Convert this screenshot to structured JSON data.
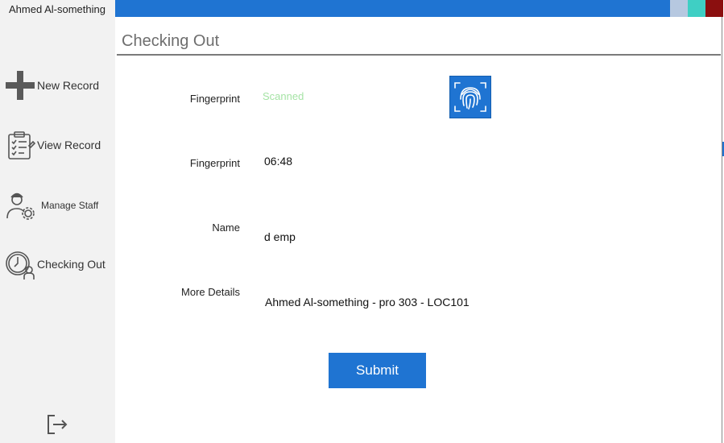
{
  "user": {
    "name": "Ahmed Al-something"
  },
  "sidebar": {
    "items": [
      {
        "label": "New Record",
        "icon": "plus-icon"
      },
      {
        "label": "View Record",
        "icon": "checklist-icon"
      },
      {
        "label": "Manage Staff",
        "icon": "staff-gear-icon"
      },
      {
        "label": "Checking Out",
        "icon": "clock-user-icon"
      }
    ],
    "logout_icon": "logout-icon"
  },
  "topbar": {
    "color": "#1f74d2",
    "squares": [
      "#b6c8e0",
      "#3fcfc4",
      "#8b0f0f"
    ]
  },
  "main": {
    "title": "Checking Out",
    "fields": [
      {
        "label": "Fingerprint",
        "value": "Scanned",
        "value_color": "#a5e3a5"
      },
      {
        "label": "Fingerprint",
        "value": "06:48"
      },
      {
        "label": "Name",
        "value": "d emp"
      },
      {
        "label": "More Details",
        "value": "Ahmed Al-something - pro 303 - LOC101"
      }
    ],
    "fingerprint_icon": "fingerprint-icon",
    "submit_label": "Submit"
  }
}
